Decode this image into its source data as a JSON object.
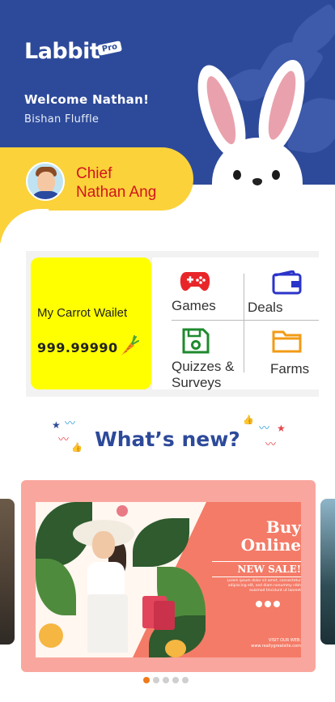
{
  "app": {
    "logo": "Labbit",
    "logo_badge": "Pro"
  },
  "header": {
    "welcome": "Welcome Nathan!",
    "subtitle": "Bishan Fluffle"
  },
  "profile": {
    "title_line1": "Chief",
    "title_line2": "Nathan Ang"
  },
  "wallet": {
    "label": "My Carrot Wailet",
    "amount": "999.99990"
  },
  "menu": {
    "items": [
      {
        "label": "Games",
        "icon": "gamepad-icon",
        "color": "#e8262a"
      },
      {
        "label": "Deals",
        "icon": "wallet-icon",
        "color": "#2b34c9"
      },
      {
        "label": "Quizzes &",
        "label2": "Surveys",
        "icon": "floppy-disk-icon",
        "color": "#1e8a2e"
      },
      {
        "label": "Farms",
        "icon": "folder-icon",
        "color": "#f29b16"
      }
    ]
  },
  "whats_new": {
    "title": "What’s new?"
  },
  "banner": {
    "headline_1": "Buy",
    "headline_2": "Online",
    "tag": "NEW SALE!",
    "body": "Lorem ipsum dolor sit amet, consectetur adipiscing elit, sed diam nonummy nibh euismod tincidunt ut laoreet",
    "visit_label": "VISIT OUR WEB:",
    "visit_url": "www.reallygreatsite.com"
  },
  "carousel": {
    "total": 5,
    "active": 0
  },
  "colors": {
    "header_blue": "#2d4a9a",
    "accent_yellow": "#fbd23a",
    "wallet_yellow": "#ffff00",
    "banner_pink": "#f9a79e",
    "dot_active": "#ef7a1a"
  }
}
